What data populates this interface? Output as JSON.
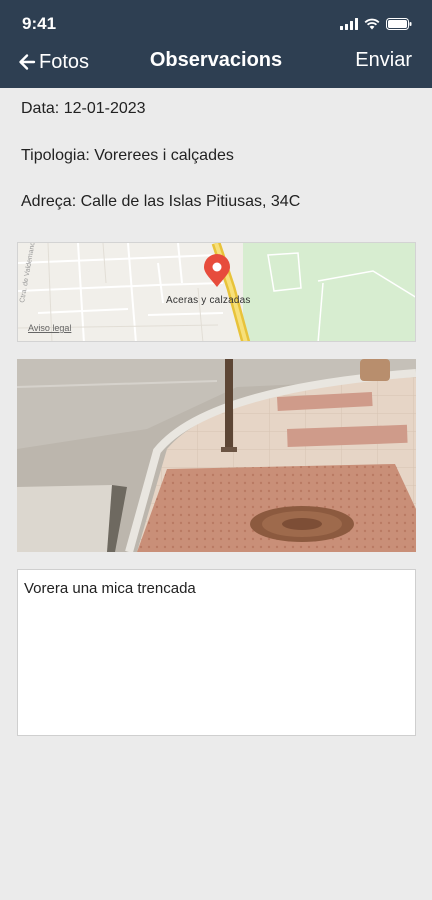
{
  "status_bar": {
    "time": "9:41"
  },
  "header": {
    "back_label": "Fotos",
    "title": "Observacions",
    "send_label": "Enviar"
  },
  "info": {
    "date": "Data: 12-01-2023",
    "type": "Tipologia: Vorerees i calçades",
    "address": "Adreça: Calle de las Islas Pitiusas, 34C"
  },
  "map": {
    "pin_label": "Aceras y calzadas",
    "legal_link": "Aviso legal",
    "street_label": "Ctra. de Valdemanco"
  },
  "notes": {
    "value": "Vorera una mica trencada"
  },
  "colors": {
    "header_bg": "#2e3f52",
    "page_bg": "#ebebeb",
    "pin": "#e74c3c",
    "road_yellow": "#f4d03f",
    "park_green": "#d7edd0"
  }
}
